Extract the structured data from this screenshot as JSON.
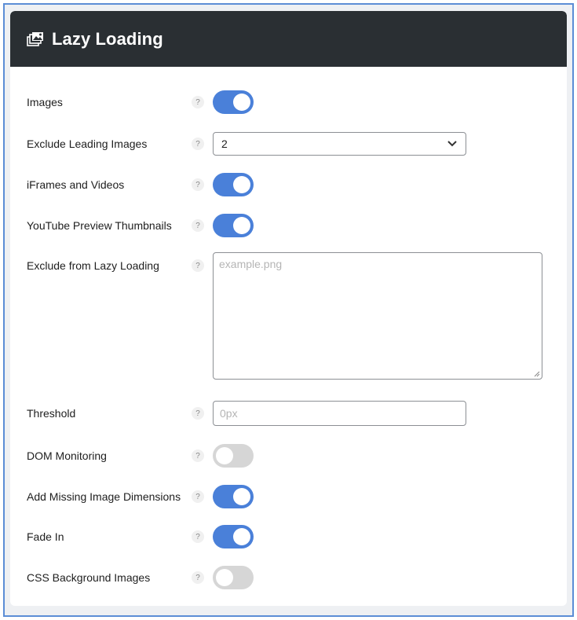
{
  "header": {
    "title": "Lazy Loading",
    "icon": "images-icon"
  },
  "settings": {
    "images": {
      "label": "Images",
      "enabled": true
    },
    "exclude_leading_images": {
      "label": "Exclude Leading Images",
      "value": "2"
    },
    "iframes_videos": {
      "label": "iFrames and Videos",
      "enabled": true
    },
    "youtube_thumbnails": {
      "label": "YouTube Preview Thumbnails",
      "enabled": true
    },
    "exclude_from_lazy": {
      "label": "Exclude from Lazy Loading",
      "value": "",
      "placeholder": "example.png"
    },
    "threshold": {
      "label": "Threshold",
      "value": "",
      "placeholder": "0px"
    },
    "dom_monitoring": {
      "label": "DOM Monitoring",
      "enabled": false
    },
    "missing_dimensions": {
      "label": "Add Missing Image Dimensions",
      "enabled": true
    },
    "fade_in": {
      "label": "Fade In",
      "enabled": true
    },
    "css_background": {
      "label": "CSS Background Images",
      "enabled": false
    }
  },
  "help_glyph": "?",
  "colors": {
    "header_bg": "#2a2f33",
    "toggle_on": "#4a80d9",
    "toggle_off": "#d6d6d6",
    "frame_border": "#5b8dd6"
  }
}
